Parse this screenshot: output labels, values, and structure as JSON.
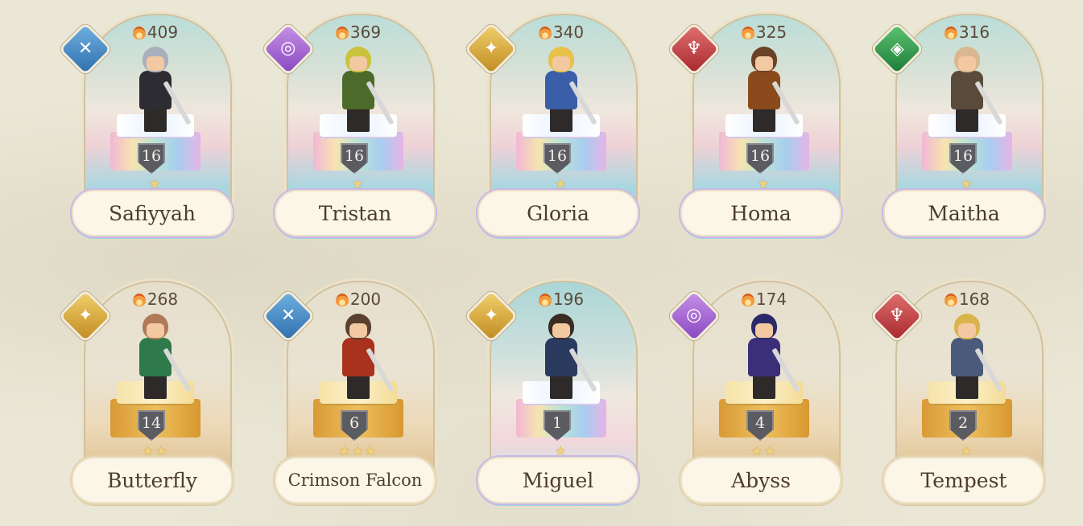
{
  "heroes": [
    {
      "name": "Safiyyah",
      "power": "409",
      "level": "16",
      "stars": "★",
      "element": "blue",
      "glyph": "✕",
      "pedestal": "rainbow",
      "arch": "rainbow",
      "hair": "#aab0bb",
      "body": "#2c2c32"
    },
    {
      "name": "Tristan",
      "power": "369",
      "level": "16",
      "stars": "★",
      "element": "purple",
      "glyph": "◎",
      "pedestal": "rainbow",
      "arch": "rainbow",
      "hair": "#c9c23a",
      "body": "#4c6a2a"
    },
    {
      "name": "Gloria",
      "power": "340",
      "level": "16",
      "stars": "★",
      "element": "gold",
      "glyph": "✦",
      "pedestal": "rainbow",
      "arch": "rainbow",
      "hair": "#e9c14a",
      "body": "#3a5ea8"
    },
    {
      "name": "Homa",
      "power": "325",
      "level": "16",
      "stars": "★",
      "element": "red",
      "glyph": "♆",
      "pedestal": "rainbow",
      "arch": "rainbow",
      "hair": "#6a4226",
      "body": "#8a4a1c"
    },
    {
      "name": "Maitha",
      "power": "316",
      "level": "16",
      "stars": "★",
      "element": "green",
      "glyph": "◈",
      "pedestal": "rainbow",
      "arch": "rainbow",
      "hair": "#d9b890",
      "body": "#5a4a3a"
    },
    {
      "name": "Butterfly",
      "power": "268",
      "level": "14",
      "stars": "★★",
      "element": "gold",
      "glyph": "✦",
      "pedestal": "gold",
      "arch": "gold",
      "hair": "#b07a5a",
      "body": "#2f7a4a"
    },
    {
      "name": "Crimson Falcon",
      "power": "200",
      "level": "6",
      "stars": "★★★",
      "element": "blue",
      "glyph": "✕",
      "pedestal": "gold",
      "arch": "gold",
      "hair": "#5a4030",
      "body": "#a8321e"
    },
    {
      "name": "Miguel",
      "power": "196",
      "level": "1",
      "stars": "★",
      "element": "gold",
      "glyph": "✦",
      "pedestal": "rainbow",
      "arch": "mixed",
      "hair": "#3a2c22",
      "body": "#2a3a5e"
    },
    {
      "name": "Abyss",
      "power": "174",
      "level": "4",
      "stars": "★★",
      "element": "purple",
      "glyph": "◎",
      "pedestal": "gold",
      "arch": "gold",
      "hair": "#2a2a6a",
      "body": "#3b2f7a"
    },
    {
      "name": "Tempest",
      "power": "168",
      "level": "2",
      "stars": "★",
      "element": "red",
      "glyph": "♆",
      "pedestal": "gold",
      "arch": "gold",
      "hair": "#d9b44a",
      "body": "#4a5a7a"
    }
  ],
  "colors": {
    "name_text": "#4e3c2c",
    "power_text": "#5a4a3a",
    "background": "#ebe7d6"
  }
}
